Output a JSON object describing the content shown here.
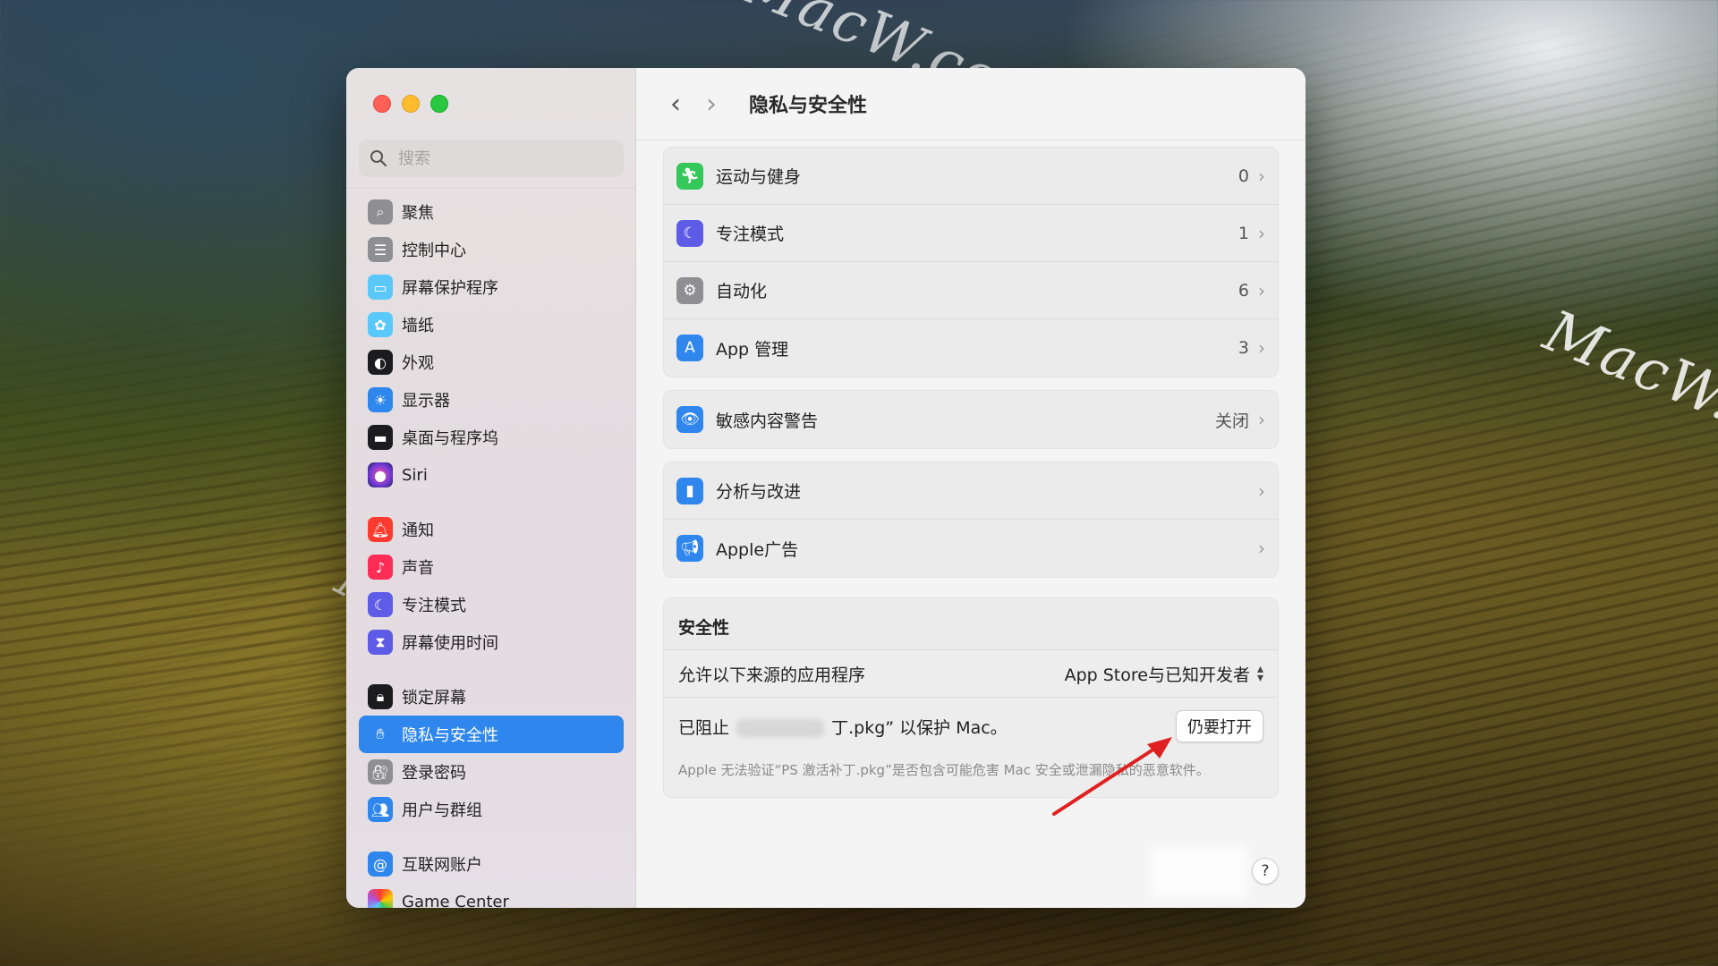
{
  "watermarks": [
    "MacW.com",
    "MacW.c",
    "MacW.com"
  ],
  "window": {
    "traffic": {
      "close_color": "#fe5f57",
      "minimize_color": "#febc2e",
      "zoom_color": "#28c840"
    },
    "title": "隐私与安全性"
  },
  "sidebar": {
    "search_placeholder": "搜索",
    "items": [
      {
        "label": "聚焦",
        "icon": "magnifier-icon",
        "color": "#8e8e93"
      },
      {
        "label": "控制中心",
        "icon": "control-center-icon",
        "color": "#8e8e93"
      },
      {
        "label": "屏幕保护程序",
        "icon": "screensaver-icon",
        "color": "#5ac8fa"
      },
      {
        "label": "墙纸",
        "icon": "wallpaper-icon",
        "color": "#5ac8fa"
      },
      {
        "label": "外观",
        "icon": "appearance-icon",
        "color": "#1c1c1e"
      },
      {
        "label": "显示器",
        "icon": "display-icon",
        "color": "#2f86ec"
      },
      {
        "label": "桌面与程序坞",
        "icon": "dock-icon",
        "color": "#1c1c1e"
      },
      {
        "label": "Siri",
        "icon": "siri-icon",
        "color": "#6e3ad8"
      },
      {
        "label": "通知",
        "icon": "notification-icon",
        "color": "#ff3b30"
      },
      {
        "label": "声音",
        "icon": "sound-icon",
        "color": "#ff2d55"
      },
      {
        "label": "专注模式",
        "icon": "focus-icon",
        "color": "#5e5ce6"
      },
      {
        "label": "屏幕使用时间",
        "icon": "hourglass-icon",
        "color": "#5e5ce6"
      },
      {
        "label": "锁定屏幕",
        "icon": "lock-icon",
        "color": "#1c1c1e"
      },
      {
        "label": "隐私与安全性",
        "icon": "hand-icon",
        "color": "#2f86ec",
        "active": true
      },
      {
        "label": "登录密码",
        "icon": "password-icon",
        "color": "#8e8e93"
      },
      {
        "label": "用户与群组",
        "icon": "users-icon",
        "color": "#2f86ec"
      },
      {
        "label": "互联网账户",
        "icon": "at-icon",
        "color": "#2f86ec"
      },
      {
        "label": "Game Center",
        "icon": "game-center-icon",
        "color": "#ffffff"
      }
    ]
  },
  "main": {
    "group1": [
      {
        "label": "运动与健身",
        "value": "0",
        "icon": "fitness-icon",
        "color": "#34c759"
      },
      {
        "label": "专注模式",
        "value": "1",
        "icon": "moon-icon",
        "color": "#5e5ce6"
      },
      {
        "label": "自动化",
        "value": "6",
        "icon": "gears-icon",
        "color": "#8e8e93"
      },
      {
        "label": "App 管理",
        "value": "3",
        "icon": "app-store-icon",
        "color": "#2f86ec"
      }
    ],
    "group2": [
      {
        "label": "敏感内容警告",
        "value": "关闭",
        "icon": "eye-icon",
        "color": "#2f86ec"
      }
    ],
    "group3": [
      {
        "label": "分析与改进",
        "value": "",
        "icon": "chart-icon",
        "color": "#2f86ec"
      },
      {
        "label": "Apple广告",
        "value": "",
        "icon": "megaphone-icon",
        "color": "#2f86ec"
      }
    ],
    "security": {
      "header": "安全性",
      "allow_label": "允许以下来源的应用程序",
      "allow_value": "App Store与已知开发者",
      "blocked_prefix": "已阻止",
      "blocked_suffix": "丁.pkg” 以保护 Mac。",
      "open_anyway": "仍要打开",
      "note": "Apple 无法验证“PS 激活补丁.pkg”是否包含可能危害 Mac 安全或泄漏隐私的恶意软件。"
    },
    "help": "?"
  }
}
